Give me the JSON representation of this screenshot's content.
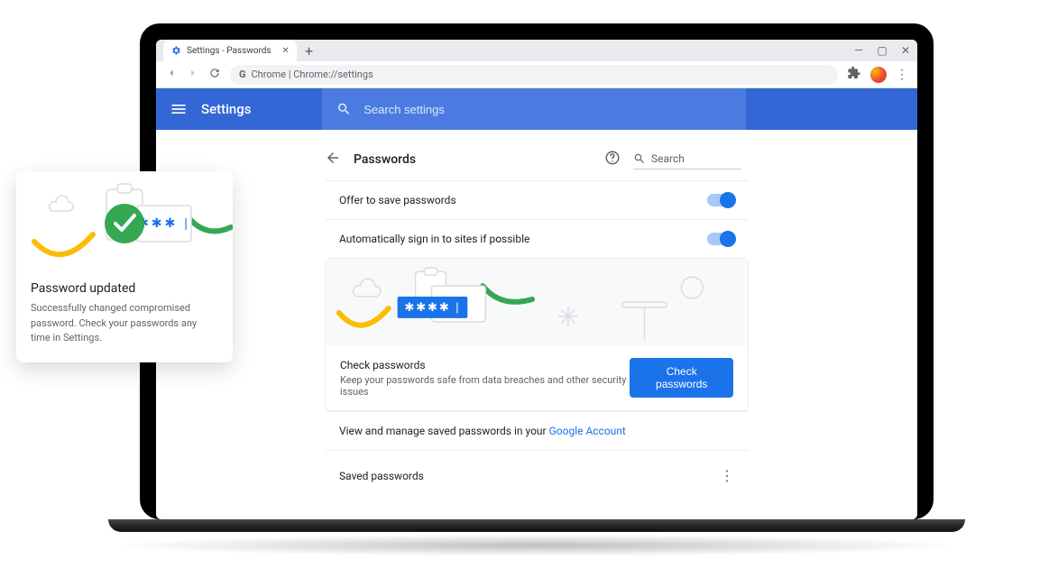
{
  "colors": {
    "primary": "#1a73e8",
    "header": "#3367d6",
    "accent_green": "#34a853",
    "accent_yellow": "#fbbc04"
  },
  "window": {
    "tab_title": "Settings - Passwords",
    "address": "Chrome | Chrome://settings"
  },
  "header": {
    "title": "Settings",
    "search_placeholder": "Search settings"
  },
  "page": {
    "title": "Passwords",
    "search_placeholder": "Search"
  },
  "rows": {
    "offer_save": "Offer to save passwords",
    "auto_signin": "Automatically sign in to sites if possible"
  },
  "check": {
    "title": "Check passwords",
    "subtitle": "Keep your passwords safe from data breaches and other security issues",
    "button": "Check passwords",
    "masked": "✱ ✱ ✱ ✱ |"
  },
  "manage": {
    "prefix": "View and manage saved passwords in your ",
    "link": "Google Account"
  },
  "saved": {
    "label": "Saved passwords"
  },
  "toast": {
    "title": "Password updated",
    "body": "Successfully changed compromised password. Check your passwords any time in Settings.",
    "masked": "✱ ✱ ✱ |"
  }
}
